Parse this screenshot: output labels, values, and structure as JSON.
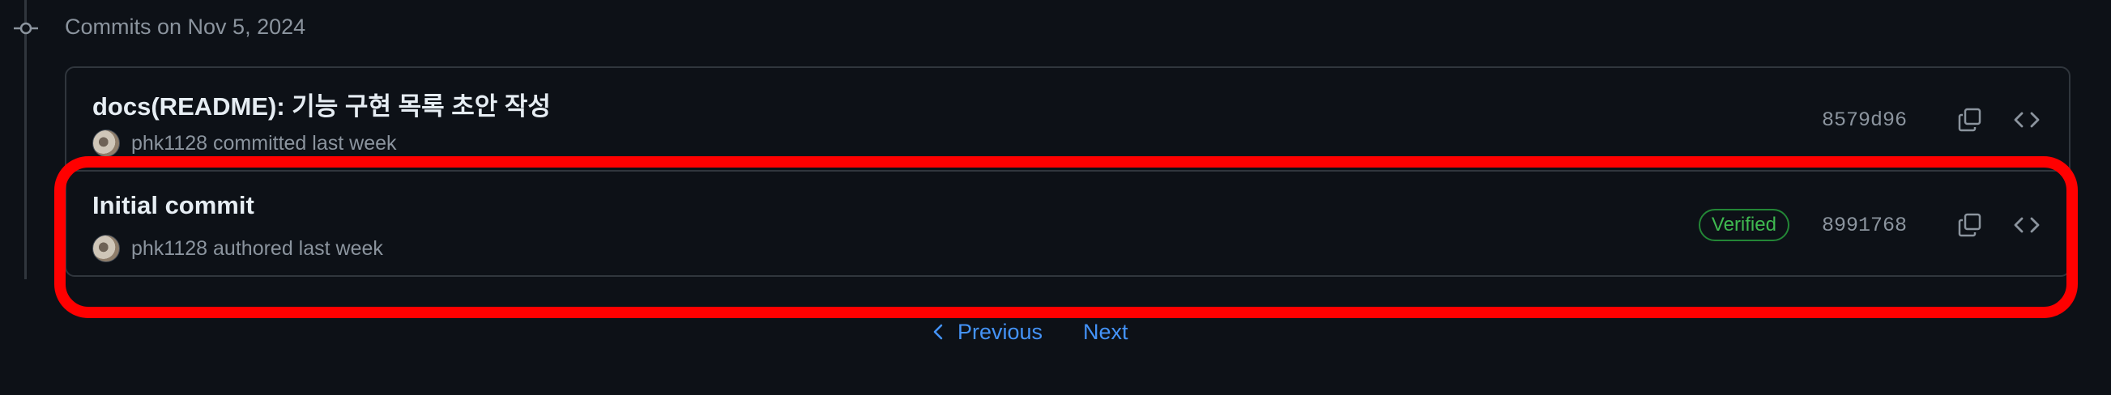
{
  "group": {
    "header": "Commits on Nov 5, 2024"
  },
  "commits": [
    {
      "title": "docs(README): 기능 구현 목록 초안 작성",
      "author": "phk1128",
      "action": "committed last week",
      "sha": "8579d96",
      "verified": false
    },
    {
      "title": "Initial commit",
      "author": "phk1128",
      "action": "authored last week",
      "sha": "8991768",
      "verified": true,
      "badge": "Verified"
    }
  ],
  "pagination": {
    "previous": "Previous",
    "next": "Next"
  },
  "icons": {
    "timeline": "git-commit-icon",
    "copy": "copy-icon",
    "browse": "code-icon",
    "prev": "chevron-left-icon"
  },
  "colors": {
    "background": "#0d1117",
    "link": "#4493f8",
    "verified": "#3fb950",
    "highlight": "#ff0000"
  }
}
